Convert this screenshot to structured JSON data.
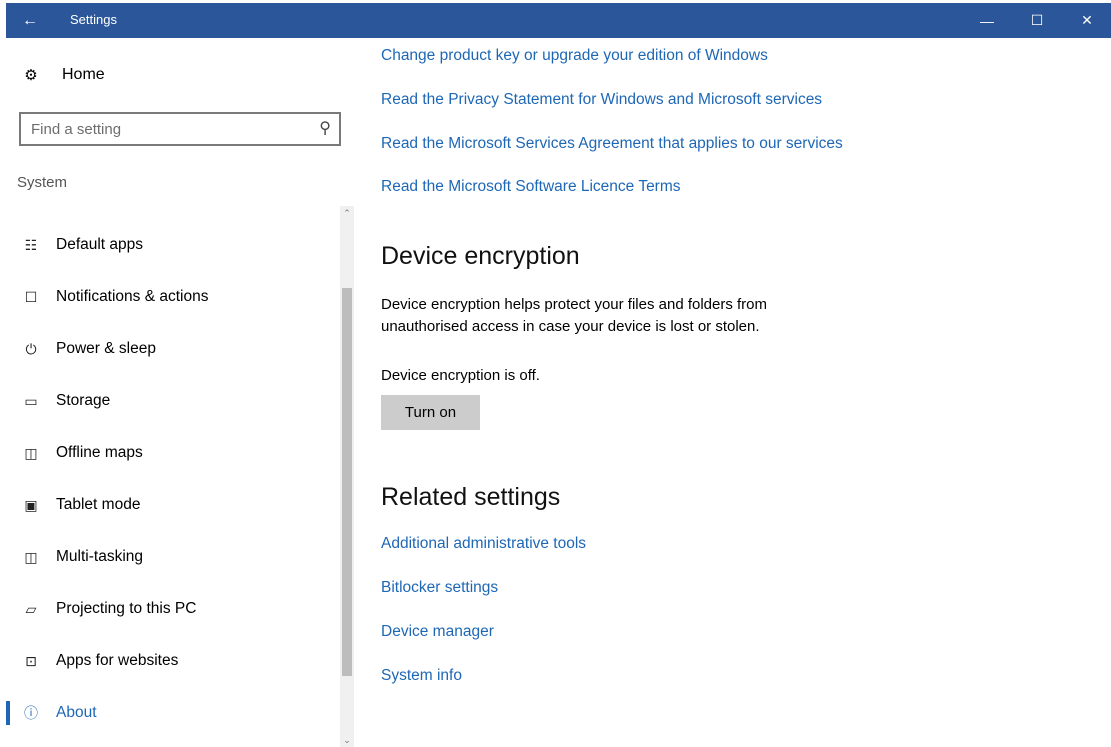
{
  "window": {
    "title": "Settings",
    "back_icon": "←",
    "minimize_icon": "—",
    "maximize_icon": "☐",
    "close_icon": "✕",
    "titlebar_color": "#2b579a"
  },
  "sidebar": {
    "home_label": "Home",
    "home_icon": "⚙",
    "search_placeholder": "Find a setting",
    "search_icon": "⚲",
    "section_label": "System",
    "items": [
      {
        "label": "Default apps",
        "icon": "☷"
      },
      {
        "label": "Notifications & actions",
        "icon": "☐"
      },
      {
        "label": "Power & sleep",
        "icon": "⏻"
      },
      {
        "label": "Storage",
        "icon": "▭"
      },
      {
        "label": "Offline maps",
        "icon": "◫"
      },
      {
        "label": "Tablet mode",
        "icon": "▣"
      },
      {
        "label": "Multi-tasking",
        "icon": "◫"
      },
      {
        "label": "Projecting to this PC",
        "icon": "▱"
      },
      {
        "label": "Apps for websites",
        "icon": "⊡"
      },
      {
        "label": "About",
        "icon": "ⓘ"
      }
    ],
    "active_item": "About",
    "accent_color": "#1e67b5"
  },
  "main": {
    "top_links": [
      "Change product key or upgrade your edition of Windows",
      "Read the Privacy Statement for Windows and Microsoft services",
      "Read the Microsoft Services Agreement that applies to our services",
      "Read the Microsoft Software Licence Terms"
    ],
    "encryption": {
      "heading": "Device encryption",
      "description_line1": "Device encryption helps protect your files and folders from",
      "description_line2": "unauthorised access in case your device is lost or stolen.",
      "status": "Device encryption is off.",
      "button_label": "Turn on"
    },
    "related": {
      "heading": "Related settings",
      "links": [
        "Additional administrative tools",
        "Bitlocker settings",
        "Device manager",
        "System info"
      ]
    }
  }
}
